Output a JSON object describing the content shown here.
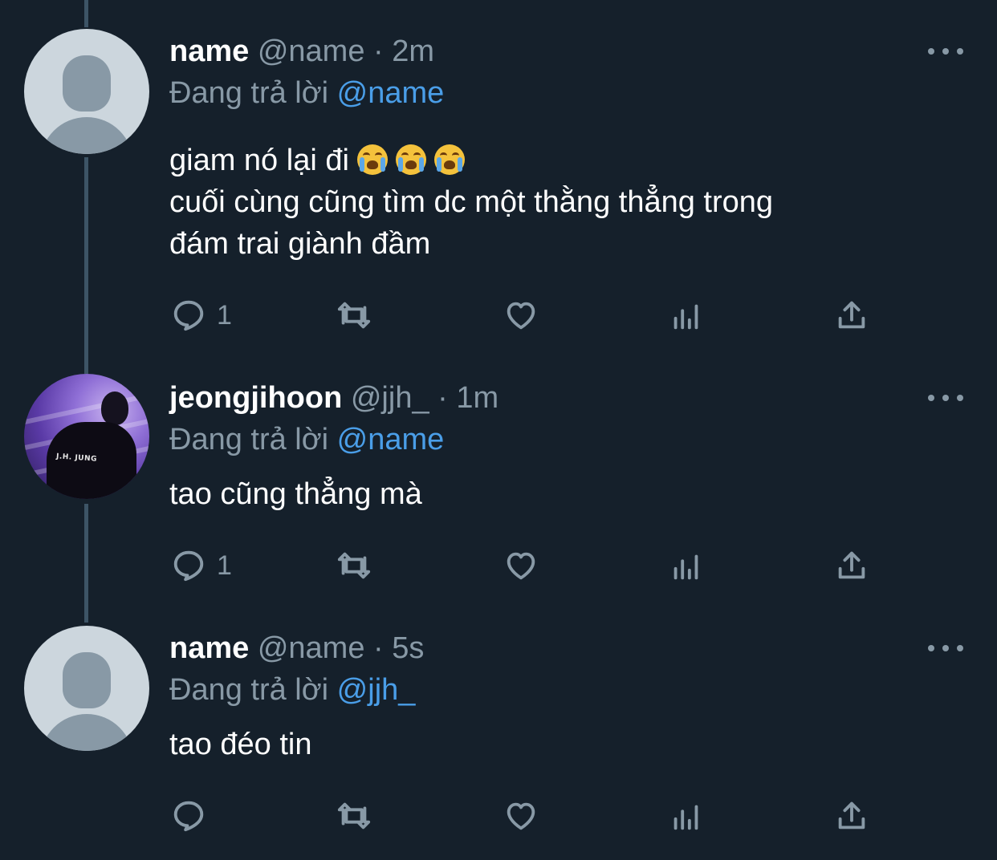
{
  "tweets": [
    {
      "display_name": "name",
      "handle": "@name",
      "separator": "·",
      "time": "2m",
      "replying_prefix": "Đang trả lời",
      "replying_to": "@name",
      "lines": [
        "giam nó lại đi",
        "cuối cùng cũng tìm dc một thằng thẳng trong",
        "đám trai giành đầm"
      ],
      "emoji": [
        "loudly-crying-face",
        "loudly-crying-face",
        "loudly-crying-face"
      ],
      "reply_count": "1",
      "avatar": "default-avatar"
    },
    {
      "display_name": "jeongjihoon",
      "handle": "@jjh_",
      "separator": "·",
      "time": "1m",
      "replying_prefix": "Đang trả lời",
      "replying_to": "@name",
      "lines": [
        "tao cũng thẳng mà"
      ],
      "reply_count": "1",
      "avatar": "photo-avatar",
      "avatar_text": "J.H. JUNG"
    },
    {
      "display_name": "name",
      "handle": "@name",
      "separator": "·",
      "time": "5s",
      "replying_prefix": "Đang trả lời",
      "replying_to": "@jjh_",
      "lines": [
        "tao đéo tin"
      ],
      "reply_count": "",
      "avatar": "default-avatar"
    }
  ],
  "icons": {
    "reply": "reply-icon",
    "retweet": "retweet-icon",
    "like": "like-icon",
    "stats": "analytics-icon",
    "share": "share-icon",
    "more": "more-options-icon"
  },
  "colors": {
    "background": "#15202b",
    "primary_text": "#ffffff",
    "secondary_text": "#8899a6",
    "mention": "#4a9ee8",
    "thread_line": "#3d5466"
  }
}
